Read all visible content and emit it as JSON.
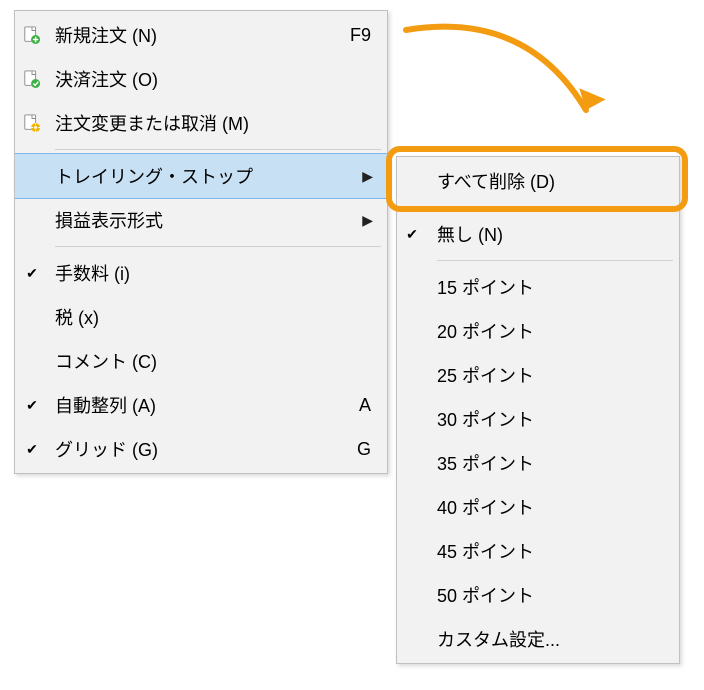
{
  "main_menu": {
    "items": [
      {
        "label": "新規注文 (N)",
        "shortcut": "F9",
        "icon": "doc-add"
      },
      {
        "label": "決済注文 (O)",
        "shortcut": "",
        "icon": "doc-check"
      },
      {
        "label": "注文変更または取消 (M)",
        "shortcut": "",
        "icon": "doc-gear"
      },
      {
        "label": "トレイリング・ストップ",
        "shortcut": "",
        "icon": "",
        "hover": true,
        "submenu": true
      },
      {
        "label": "損益表示形式",
        "shortcut": "",
        "icon": "",
        "submenu": true
      },
      {
        "label": "手数料 (i)",
        "shortcut": "",
        "icon": "",
        "checked": true
      },
      {
        "label": "税 (x)",
        "shortcut": "",
        "icon": ""
      },
      {
        "label": "コメント (C)",
        "shortcut": "",
        "icon": ""
      },
      {
        "label": "自動整列 (A)",
        "shortcut": "A",
        "icon": "",
        "checked": true
      },
      {
        "label": "グリッド (G)",
        "shortcut": "G",
        "icon": "",
        "checked": true
      }
    ],
    "separators_after": [
      2,
      4
    ]
  },
  "sub_menu": {
    "items": [
      {
        "label": "すべて削除 (D)"
      },
      {
        "label": "無し (N)",
        "checked": true
      },
      {
        "label": "15 ポイント"
      },
      {
        "label": "20 ポイント"
      },
      {
        "label": "25 ポイント"
      },
      {
        "label": "30 ポイント"
      },
      {
        "label": "35 ポイント"
      },
      {
        "label": "40 ポイント"
      },
      {
        "label": "45 ポイント"
      },
      {
        "label": "50 ポイント"
      },
      {
        "label": "カスタム設定..."
      }
    ],
    "separators_after": [
      0,
      1
    ]
  },
  "colors": {
    "highlight_border": "#f39c12",
    "hover_bg": "#c7e0f4"
  }
}
